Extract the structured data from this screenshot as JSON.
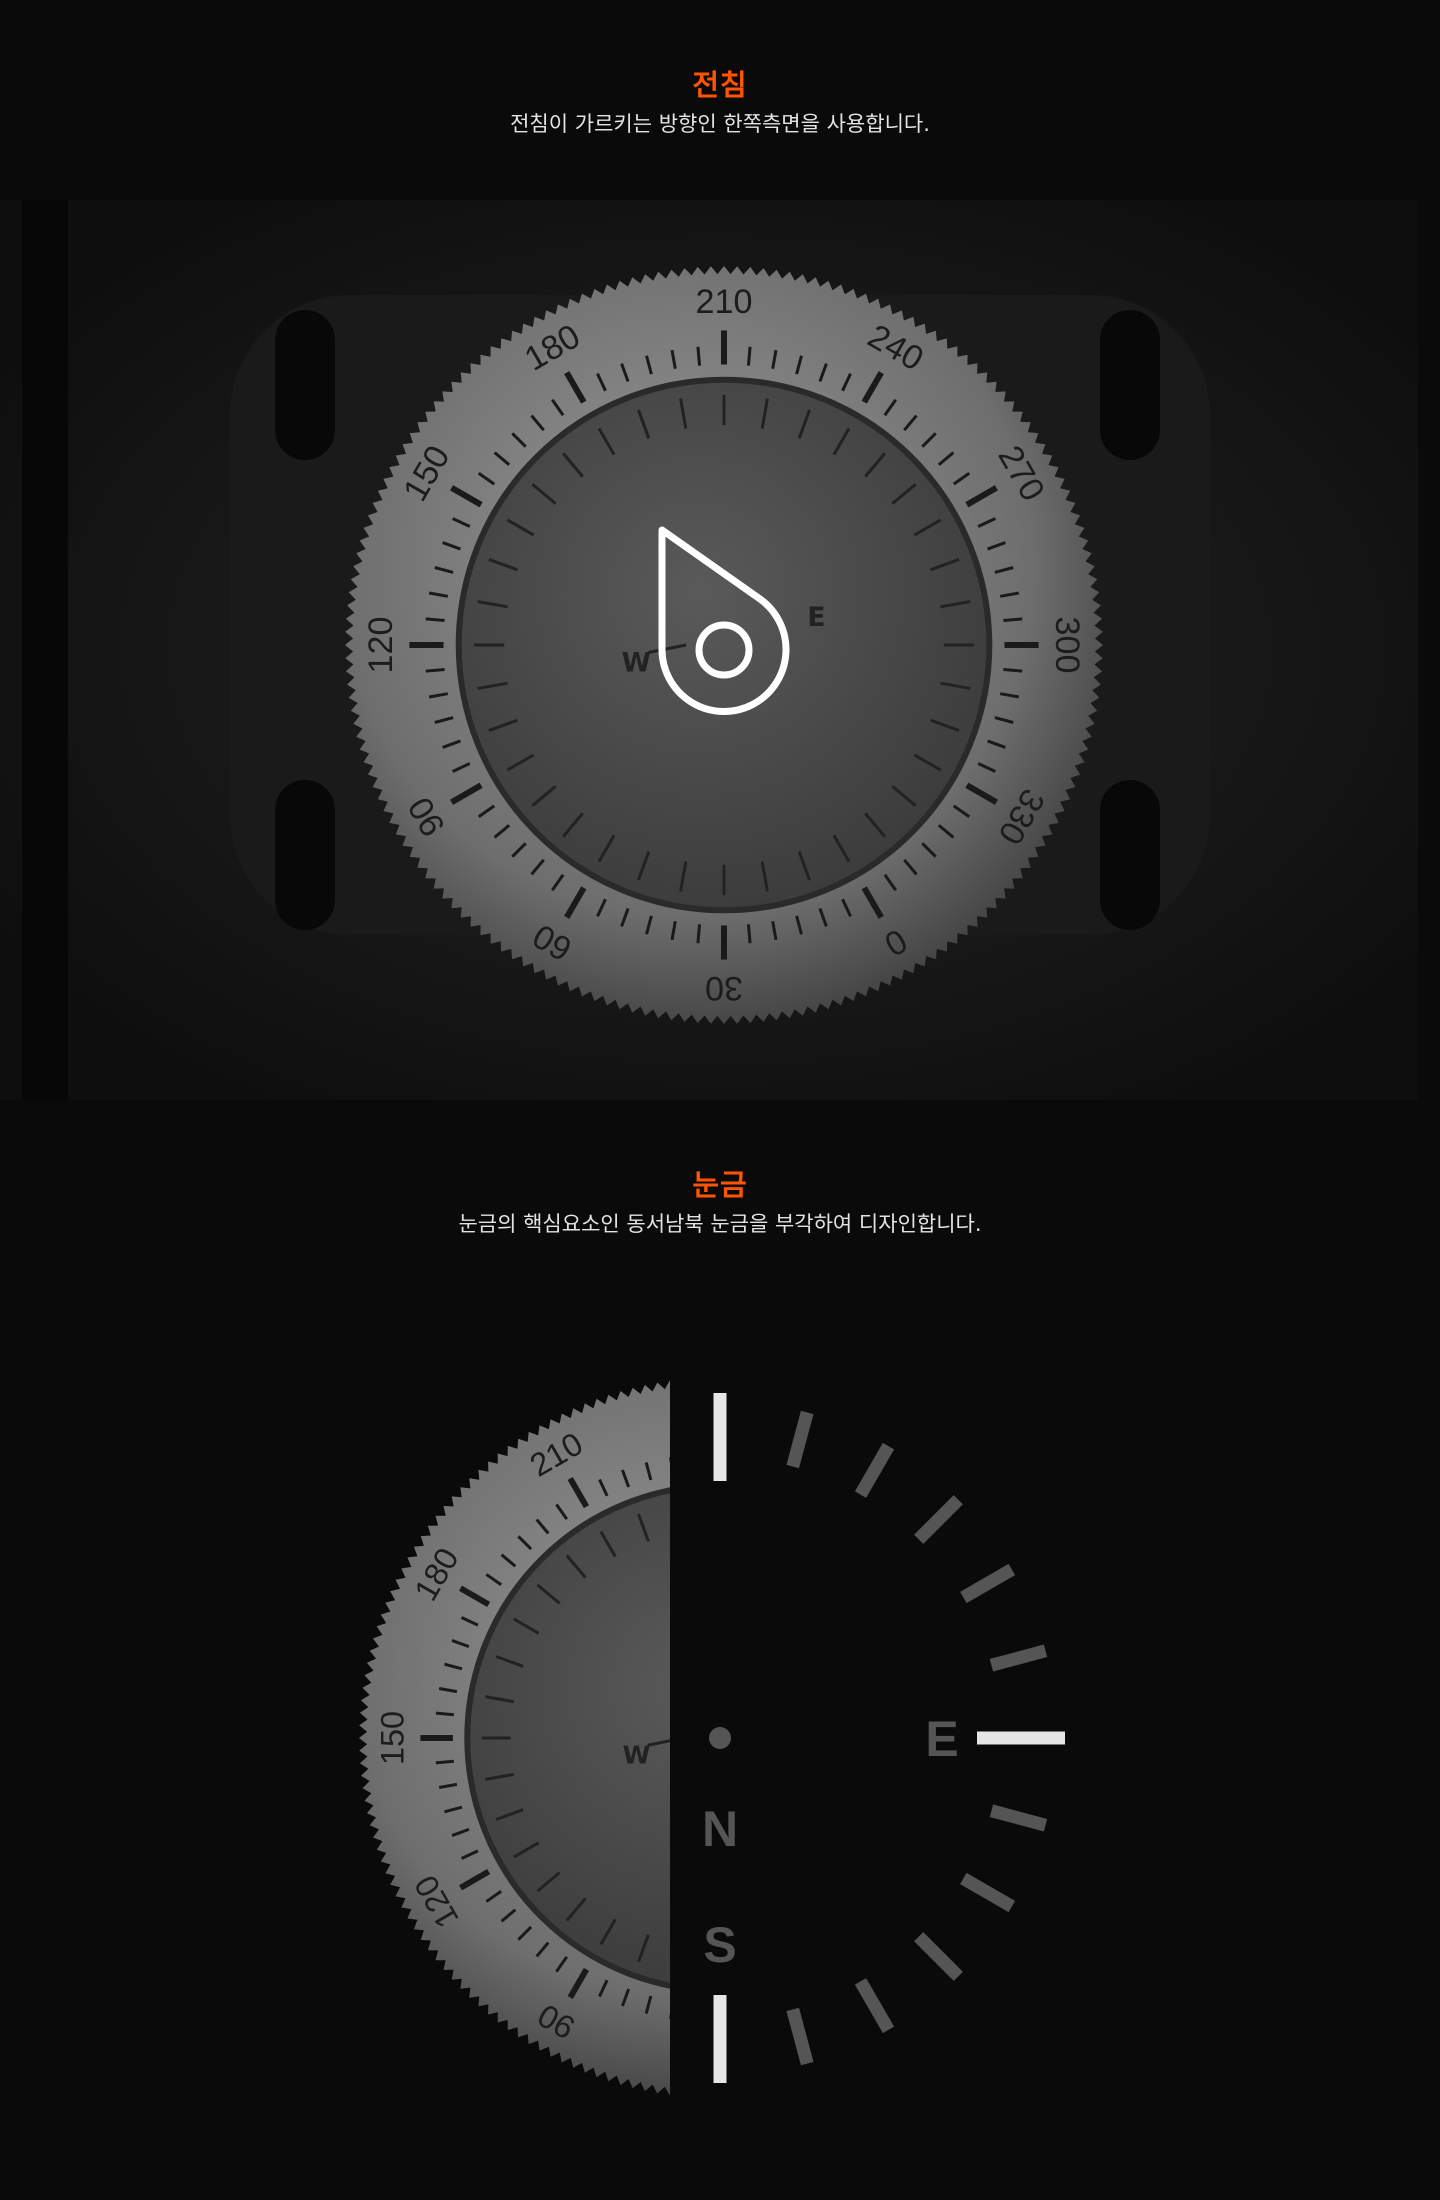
{
  "sections": [
    {
      "title": "전침",
      "description": "전침이 가르키는 방향인 한쪽측면을 사용합니다."
    },
    {
      "title": "눈금",
      "description": "눈금의 핵심요소인 동서남북 눈금을 부각하여 디자인합니다."
    }
  ],
  "photo": {
    "bezel_numbers": [
      "210",
      "240",
      "270",
      "300",
      "330",
      "0",
      "30",
      "60",
      "90",
      "120",
      "150",
      "180"
    ],
    "dial_letters": {
      "west": "W",
      "east": "E"
    }
  },
  "scale_graphic": {
    "north": "N",
    "east": "E",
    "south": "S"
  },
  "colors": {
    "accent": "#ff5400",
    "major_tick": "#e6e6e6",
    "minor_tick": "#555555",
    "background": "#0a0a0a"
  }
}
